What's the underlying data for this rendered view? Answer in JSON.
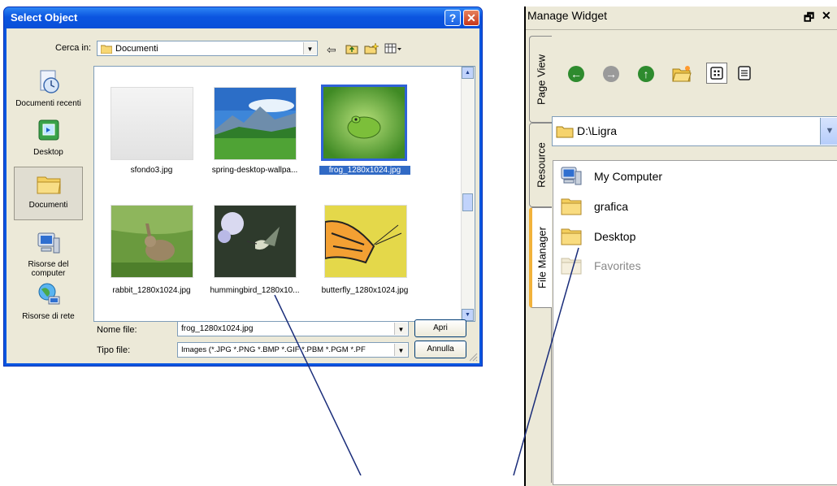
{
  "dialog": {
    "title": "Select Object",
    "help_label": "?",
    "close_label": "✕",
    "look_in_label": "Cerca in:",
    "look_in_value": "Documenti",
    "places": [
      {
        "label": "Documenti recenti",
        "icon": "recent-documents-icon"
      },
      {
        "label": "Desktop",
        "icon": "desktop-icon"
      },
      {
        "label": "Documenti",
        "icon": "documents-folder-icon",
        "selected": true
      },
      {
        "label": "Risorse del computer",
        "icon": "my-computer-icon"
      },
      {
        "label": "Risorse di rete",
        "icon": "network-places-icon"
      }
    ],
    "files": [
      {
        "name": "sfondo3.jpg",
        "thumb": "blank-thumbnail"
      },
      {
        "name": "spring-desktop-wallpa...",
        "thumb": "mountain-thumbnail"
      },
      {
        "name": "frog_1280x1024.jpg",
        "thumb": "frog-thumbnail",
        "selected": true
      },
      {
        "name": "rabbit_1280x1024.jpg",
        "thumb": "rabbit-thumbnail"
      },
      {
        "name": "hummingbird_1280x10...",
        "thumb": "hummingbird-thumbnail"
      },
      {
        "name": "butterfly_1280x1024.jpg",
        "thumb": "butterfly-thumbnail"
      }
    ],
    "filename_label": "Nome file:",
    "filename_value": "frog_1280x1024.jpg",
    "filetype_label": "Tipo file:",
    "filetype_value": "Images (*.JPG *.PNG *.BMP *.GIF *.PBM *.PGM *.PF",
    "open_label": "Apri",
    "cancel_label": "Annulla"
  },
  "widget": {
    "title": "Manage Widget",
    "float_label": "🗗",
    "close_label": "✕",
    "tabs": [
      "Page View",
      "Resource",
      "File Manager"
    ],
    "active_tab": "File Manager",
    "path": "D:\\Ligra",
    "tree": [
      {
        "label": "My Computer",
        "icon": "my-computer-icon"
      },
      {
        "label": "grafica",
        "icon": "folder-icon"
      },
      {
        "label": "Desktop",
        "icon": "folder-icon"
      },
      {
        "label": "Favorites",
        "icon": "folder-icon",
        "dimmed": true
      }
    ]
  },
  "colors": {
    "titlebar": "#0b55e0",
    "selection": "#316ac5",
    "dialog_face": "#ece9d8",
    "active_tab_accent": "#f2b23a"
  }
}
